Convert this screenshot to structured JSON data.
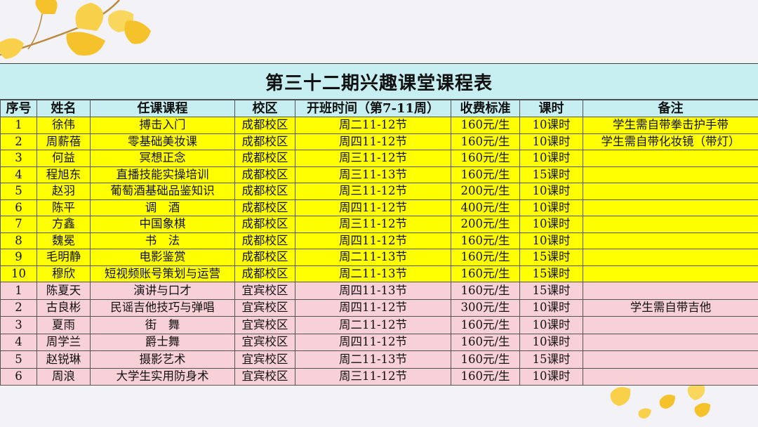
{
  "title": "第三十二期兴趣课堂课程表",
  "columns": [
    "序号",
    "姓名",
    "任课课程",
    "校区",
    "开班时间（第7-11周）",
    "收费标准",
    "课时",
    "备注"
  ],
  "rows": [
    {
      "no": "1",
      "name": "徐伟",
      "course": "搏击入门",
      "campus": "成都校区",
      "time": "周二11-12节",
      "fee": "160元/生",
      "hours": "10课时",
      "note": "学生需自带拳击护手带"
    },
    {
      "no": "2",
      "name": "周薪蓓",
      "course": "零基础美妆课",
      "campus": "成都校区",
      "time": "周四11-12节",
      "fee": "160元/生",
      "hours": "10课时",
      "note": "学生需自带化妆镜（带灯）"
    },
    {
      "no": "3",
      "name": "何益",
      "course": "冥想正念",
      "campus": "成都校区",
      "time": "周三11-12节",
      "fee": "160元/生",
      "hours": "10课时",
      "note": ""
    },
    {
      "no": "4",
      "name": "程旭东",
      "course": "直播技能实操培训",
      "campus": "成都校区",
      "time": "周三11-13节",
      "fee": "160元/生",
      "hours": "15课时",
      "note": ""
    },
    {
      "no": "5",
      "name": "赵羽",
      "course": "葡萄酒基础品鉴知识",
      "campus": "成都校区",
      "time": "周三11-12节",
      "fee": "200元/生",
      "hours": "10课时",
      "note": ""
    },
    {
      "no": "6",
      "name": "陈平",
      "course": "调　酒",
      "campus": "成都校区",
      "time": "周四11-12节",
      "fee": "400元/生",
      "hours": "10课时",
      "note": ""
    },
    {
      "no": "7",
      "name": "方鑫",
      "course": "中国象棋",
      "campus": "成都校区",
      "time": "周三11-12节",
      "fee": "200元/生",
      "hours": "10课时",
      "note": ""
    },
    {
      "no": "8",
      "name": "魏冕",
      "course": "书　法",
      "campus": "成都校区",
      "time": "周四11-12节",
      "fee": "160元/生",
      "hours": "10课时",
      "note": ""
    },
    {
      "no": "9",
      "name": "毛明静",
      "course": "电影鉴赏",
      "campus": "成都校区",
      "time": "周二11-13节",
      "fee": "160元/生",
      "hours": "15课时",
      "note": ""
    },
    {
      "no": "10",
      "name": "穆欣",
      "course": "短视频账号策划与运营",
      "campus": "成都校区",
      "time": "周二11-13节",
      "fee": "160元/生",
      "hours": "15课时",
      "note": ""
    },
    {
      "no": "1",
      "name": "陈夏天",
      "course": "演讲与口才",
      "campus": "宜宾校区",
      "time": "周四11-13节",
      "fee": "160元/生",
      "hours": "15课时",
      "note": ""
    },
    {
      "no": "2",
      "name": "古良彬",
      "course": "民谣吉他技巧与弹唱",
      "campus": "宜宾校区",
      "time": "周四11-12节",
      "fee": "300元/生",
      "hours": "10课时",
      "note": "学生需自带吉他"
    },
    {
      "no": "3",
      "name": "夏雨",
      "course": "街　舞",
      "campus": "宜宾校区",
      "time": "周二11-12节",
      "fee": "160元/生",
      "hours": "10课时",
      "note": ""
    },
    {
      "no": "4",
      "name": "周学兰",
      "course": "爵士舞",
      "campus": "宜宾校区",
      "time": "周四11-12节",
      "fee": "160元/生",
      "hours": "10课时",
      "note": ""
    },
    {
      "no": "5",
      "name": "赵锐琳",
      "course": "摄影艺术",
      "campus": "宜宾校区",
      "time": "周二11-13节",
      "fee": "160元/生",
      "hours": "15课时",
      "note": ""
    },
    {
      "no": "6",
      "name": "周浪",
      "course": "大学生实用防身术",
      "campus": "宜宾校区",
      "time": "周三11-12节",
      "fee": "160元/生",
      "hours": "10课时",
      "note": ""
    }
  ],
  "colors": {
    "header_bg": "#c7eff1",
    "chengdu_bg": "#ffff00",
    "yibin_bg": "#f8d0d8",
    "leaf": "#f6c22b"
  },
  "decor": {
    "top_left": "ginkgo-leaf-branch-icon",
    "bottom_right": "ginkgo-leaves-icon"
  }
}
